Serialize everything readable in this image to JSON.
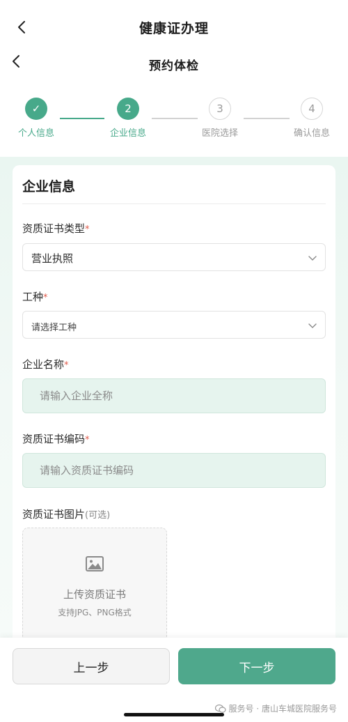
{
  "header": {
    "outer_title": "健康证办理",
    "inner_title": "预约体检"
  },
  "stepper": {
    "steps": [
      {
        "number": "✓",
        "label": "个人信息",
        "state": "done"
      },
      {
        "number": "2",
        "label": "企业信息",
        "state": "active"
      },
      {
        "number": "3",
        "label": "医院选择",
        "state": "todo"
      },
      {
        "number": "4",
        "label": "确认信息",
        "state": "todo"
      }
    ]
  },
  "form": {
    "section_title": "企业信息",
    "cert_type": {
      "label": "资质证书类型",
      "required_mark": "*",
      "value": "营业执照"
    },
    "job_type": {
      "label": "工种",
      "required_mark": "*",
      "placeholder": "请选择工种"
    },
    "company_name": {
      "label": "企业名称",
      "required_mark": "*",
      "placeholder": "请输入企业全称"
    },
    "cert_number": {
      "label": "资质证书编码",
      "required_mark": "*",
      "placeholder": "请输入资质证书编码"
    },
    "cert_image": {
      "label": "资质证书图片",
      "optional_note": "(可选)",
      "upload_title": "上传资质证书",
      "upload_hint": "支持JPG、PNG格式"
    }
  },
  "footer": {
    "prev_label": "上一步",
    "next_label": "下一步",
    "watermark": "服务号 · 唐山车城医院服务号"
  },
  "colors": {
    "accent": "#47a98a",
    "next_button": "#4fa88c",
    "required": "#e05a4a"
  }
}
